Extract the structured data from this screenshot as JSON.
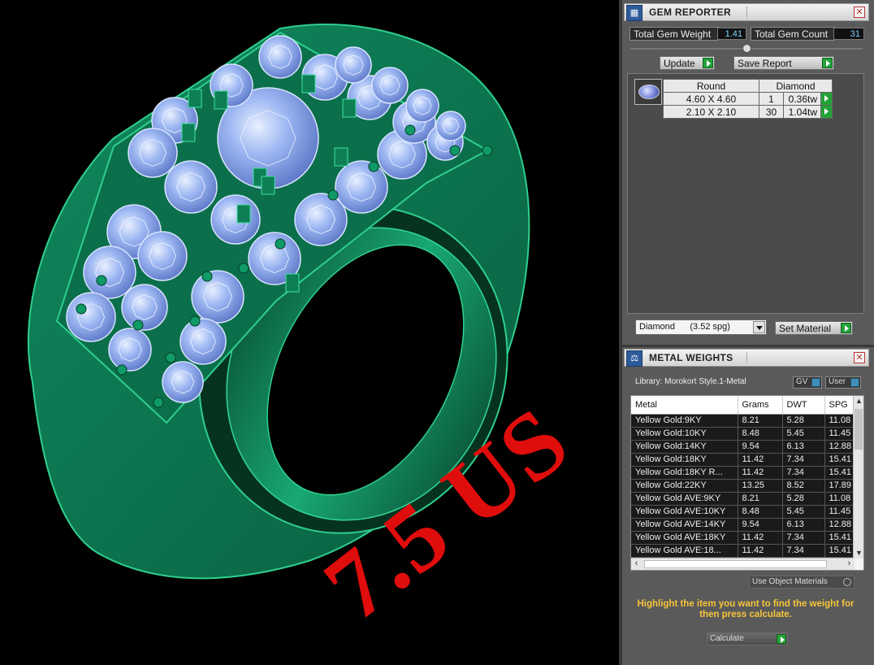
{
  "viewport": {
    "size_label": "7.5 US"
  },
  "gem_reporter": {
    "title": "GEM REPORTER",
    "total_weight_label": "Total Gem Weight",
    "total_weight_value": "1.41",
    "total_count_label": "Total Gem Count",
    "total_count_value": "31",
    "update_label": "Update",
    "save_report_label": "Save Report",
    "table": {
      "shape": "Round",
      "material": "Diamond",
      "rows": [
        {
          "size": "4.60 X 4.60",
          "count": "1",
          "weight": "0.36tw"
        },
        {
          "size": "2.10 X 2.10",
          "count": "30",
          "weight": "1.04tw"
        }
      ]
    },
    "material_select": "Diamond      (3.52 spg)",
    "set_material_label": "Set Material"
  },
  "metal_weights": {
    "title": "METAL WEIGHTS",
    "library": "Library: Morokort Style.1-Metal",
    "gv_label": "GV",
    "user_label": "User",
    "columns": [
      "Metal",
      "Grams",
      "DWT",
      "SPG"
    ],
    "rows": [
      {
        "metal": "Yellow Gold:9KY",
        "grams": "8.21",
        "dwt": "5.28",
        "spg": "11.08"
      },
      {
        "metal": "Yellow Gold:10KY",
        "grams": "8.48",
        "dwt": "5.45",
        "spg": "11.45"
      },
      {
        "metal": "Yellow Gold:14KY",
        "grams": "9.54",
        "dwt": "6.13",
        "spg": "12.88"
      },
      {
        "metal": "Yellow Gold:18KY",
        "grams": "11.42",
        "dwt": "7.34",
        "spg": "15.41"
      },
      {
        "metal": "Yellow Gold:18KY R...",
        "grams": "11.42",
        "dwt": "7.34",
        "spg": "15.41"
      },
      {
        "metal": "Yellow Gold:22KY",
        "grams": "13.25",
        "dwt": "8.52",
        "spg": "17.89"
      },
      {
        "metal": "Yellow Gold AVE:9KY",
        "grams": "8.21",
        "dwt": "5.28",
        "spg": "11.08"
      },
      {
        "metal": "Yellow Gold AVE:10KY",
        "grams": "8.48",
        "dwt": "5.45",
        "spg": "11.45"
      },
      {
        "metal": "Yellow Gold AVE:14KY",
        "grams": "9.54",
        "dwt": "6.13",
        "spg": "12.88"
      },
      {
        "metal": "Yellow Gold AVE:18KY",
        "grams": "11.42",
        "dwt": "7.34",
        "spg": "15.41"
      },
      {
        "metal": "Yellow Gold AVE:18...",
        "grams": "11.42",
        "dwt": "7.34",
        "spg": "15.41"
      }
    ],
    "use_object_materials": "Use Object Materials",
    "hint": "Highlight the item you want to find the weight for then press calculate.",
    "calculate_label": "Calculate"
  }
}
